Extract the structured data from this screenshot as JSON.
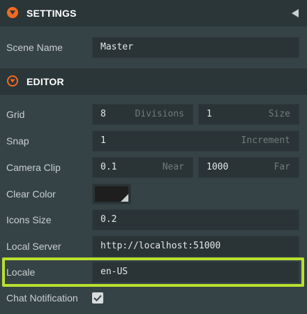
{
  "settings": {
    "title": "SETTINGS",
    "accent": "#f26a21",
    "scene_name": {
      "label": "Scene Name",
      "value": "Master"
    }
  },
  "editor": {
    "title": "EDITOR",
    "grid": {
      "label": "Grid",
      "divisions_value": "8",
      "divisions_suffix": "Divisions",
      "size_value": "1",
      "size_suffix": "Size"
    },
    "snap": {
      "label": "Snap",
      "value": "1",
      "suffix": "Increment"
    },
    "camera_clip": {
      "label": "Camera Clip",
      "near_value": "0.1",
      "near_suffix": "Near",
      "far_value": "1000",
      "far_suffix": "Far"
    },
    "clear_color": {
      "label": "Clear Color",
      "value": "#1e1e1e"
    },
    "icons_size": {
      "label": "Icons Size",
      "value": "0.2"
    },
    "local_server": {
      "label": "Local Server",
      "value": "http://localhost:51000"
    },
    "locale": {
      "label": "Locale",
      "value": "en-US"
    },
    "chat_notification": {
      "label": "Chat Notification",
      "checked": true
    }
  },
  "highlight_color": "#b8e02e"
}
